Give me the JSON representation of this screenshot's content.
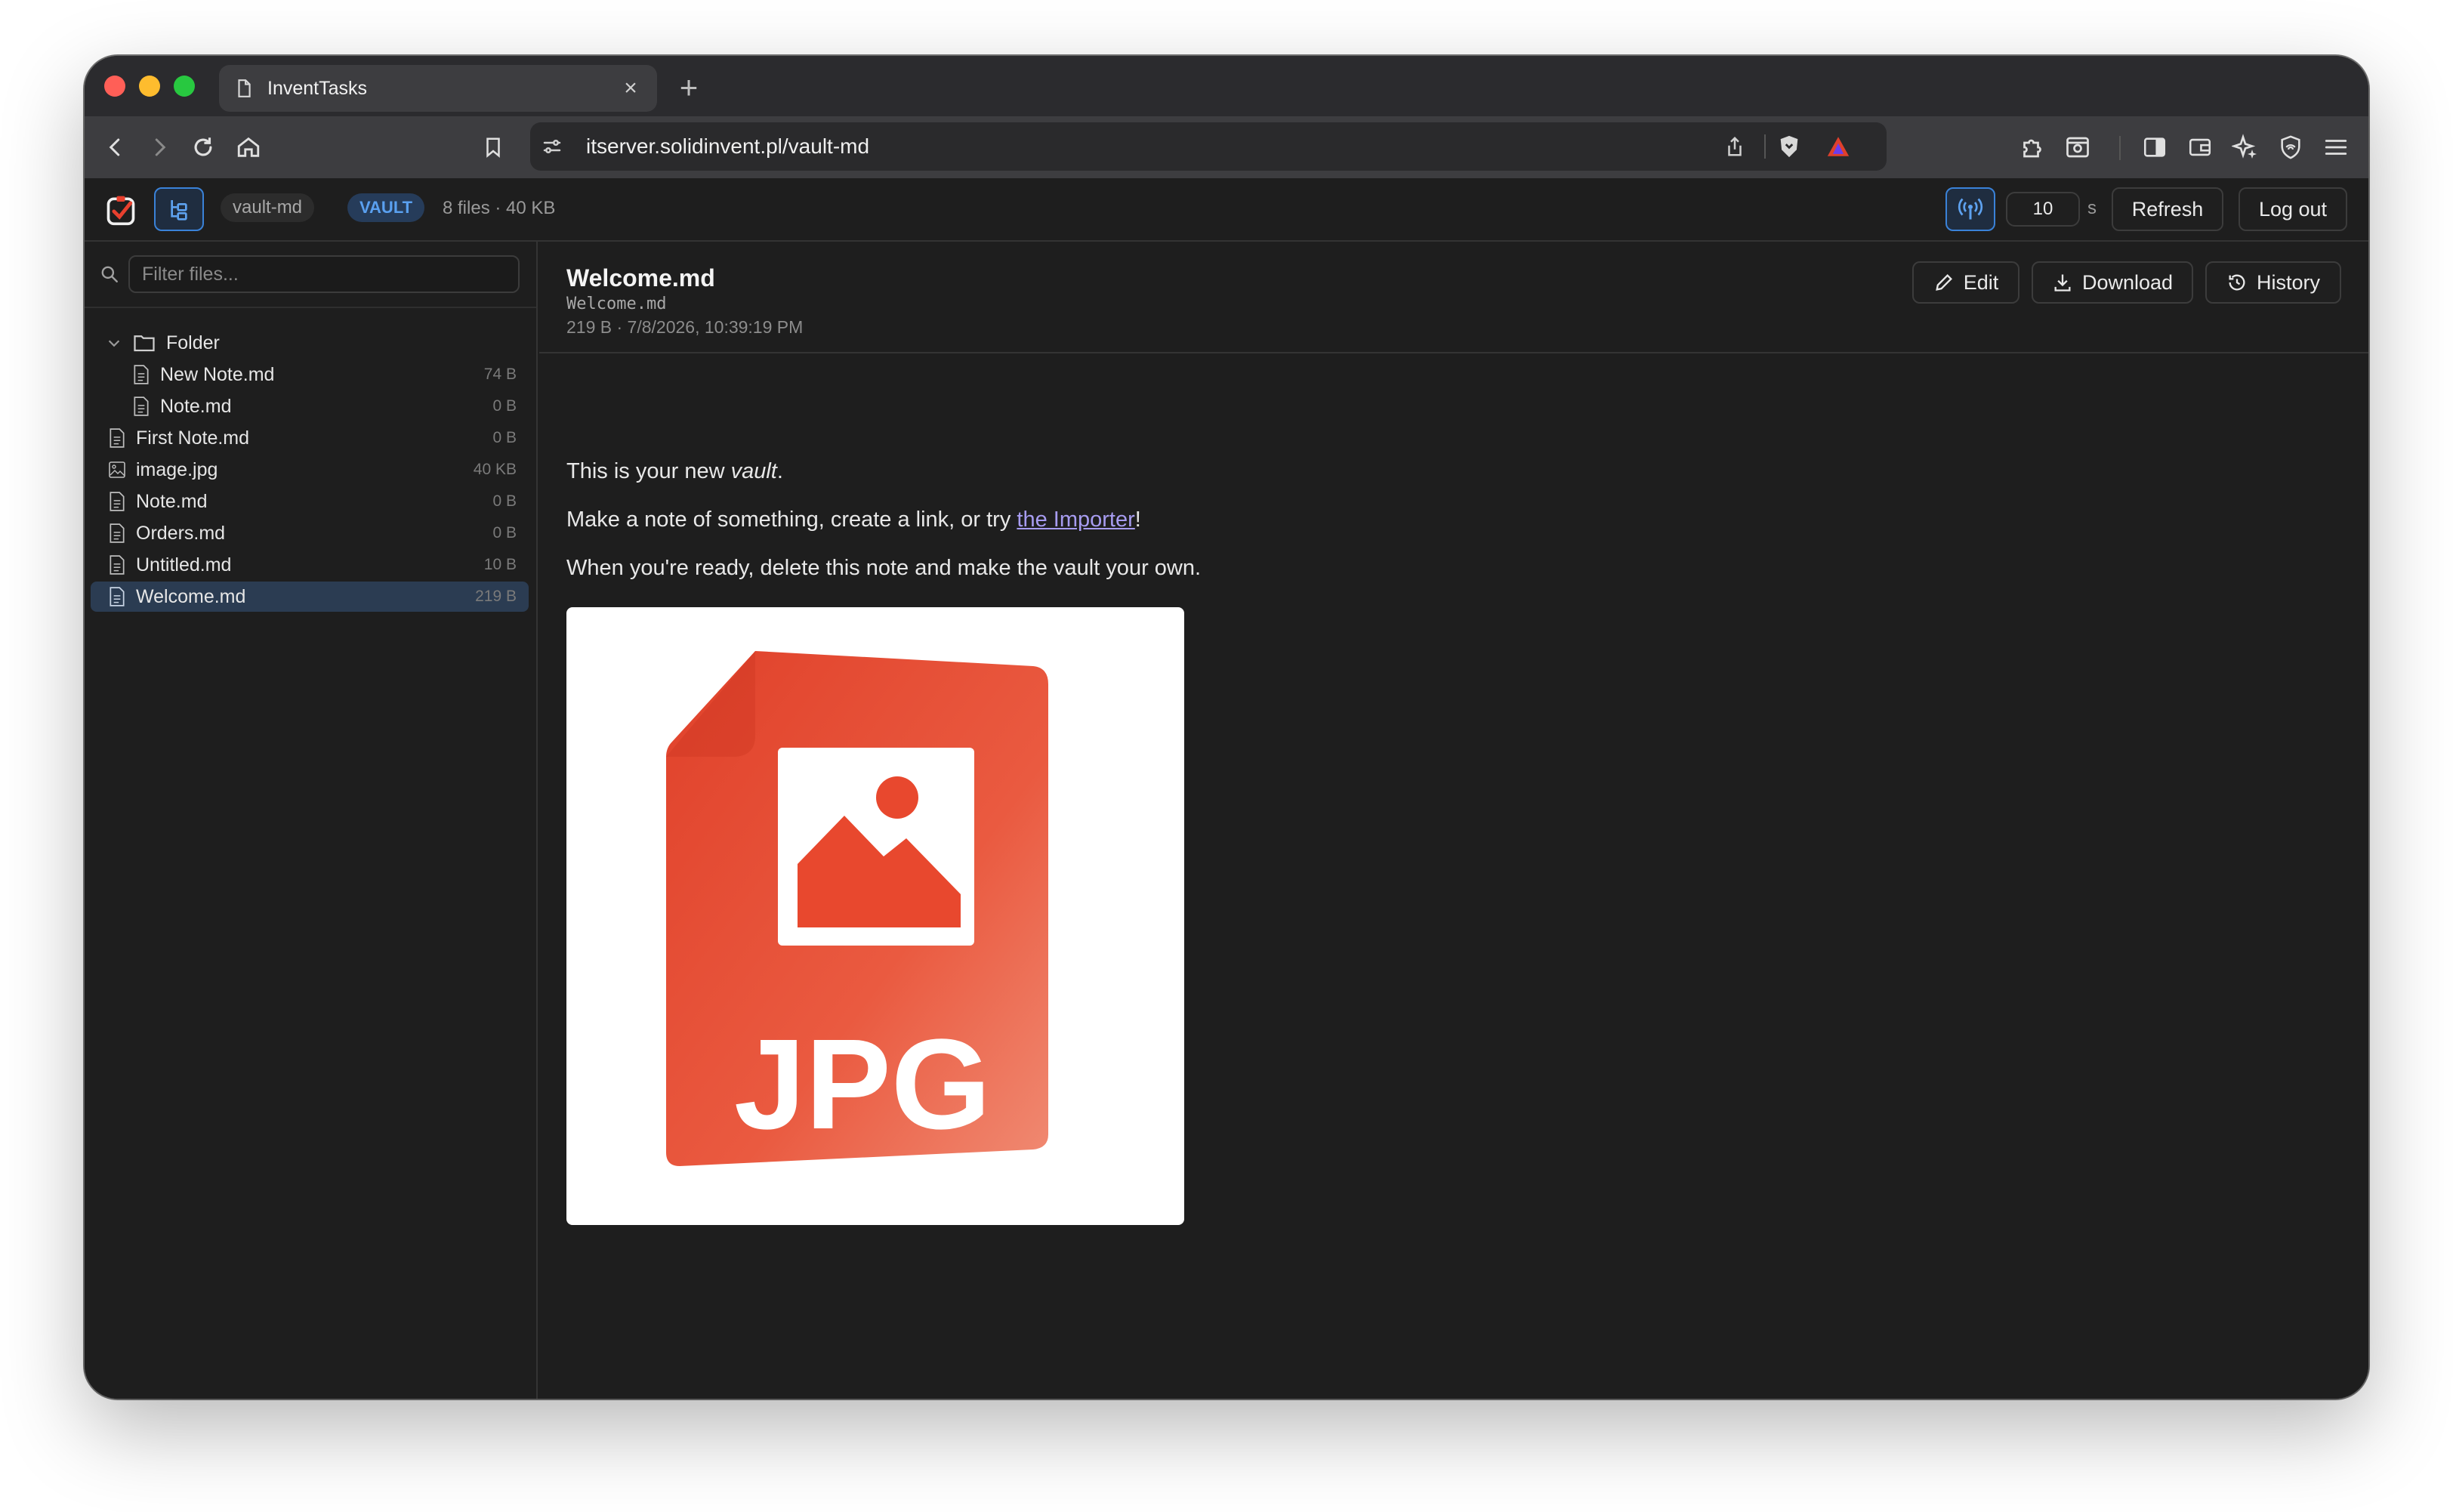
{
  "browser": {
    "tab_title": "InventTasks",
    "tab_close": "×",
    "new_tab": "+",
    "url": "itserver.solidinvent.pl/vault-md"
  },
  "app": {
    "vault_name": "vault-md",
    "vault_badge": "VAULT",
    "vault_stats": "8 files · 40 KB",
    "refresh_interval": "10",
    "refresh_unit": "s",
    "refresh_label": "Refresh",
    "logout_label": "Log out"
  },
  "sidebar": {
    "filter_placeholder": "Filter files...",
    "folder_name": "Folder",
    "folder_files": [
      {
        "name": "New Note.md",
        "size": "74 B"
      },
      {
        "name": "Note.md",
        "size": "0 B"
      }
    ],
    "root_files": [
      {
        "name": "First Note.md",
        "size": "0 B"
      },
      {
        "name": "image.jpg",
        "size": "40 KB"
      },
      {
        "name": "Note.md",
        "size": "0 B"
      },
      {
        "name": "Orders.md",
        "size": "0 B"
      },
      {
        "name": "Untitled.md",
        "size": "10 B"
      },
      {
        "name": "Welcome.md",
        "size": "219 B"
      }
    ]
  },
  "document": {
    "title": "Welcome.md",
    "path": "Welcome.md",
    "meta": "219 B · 7/8/2026, 10:39:19 PM",
    "edit_label": "Edit",
    "download_label": "Download",
    "history_label": "History",
    "para1_prefix": "This is your new ",
    "para1_emph": "vault",
    "para1_suffix": ".",
    "para2_prefix": "Make a note of something, create a link, or try ",
    "para2_link": "the Importer",
    "para2_suffix": "!",
    "para3": "When you're ready, delete this note and make the vault your own.",
    "image_text": "JPG"
  },
  "colors": {
    "accent_blue": "#4a8fe0",
    "link": "#a79cf0",
    "jpg_red": "#e84a30"
  }
}
